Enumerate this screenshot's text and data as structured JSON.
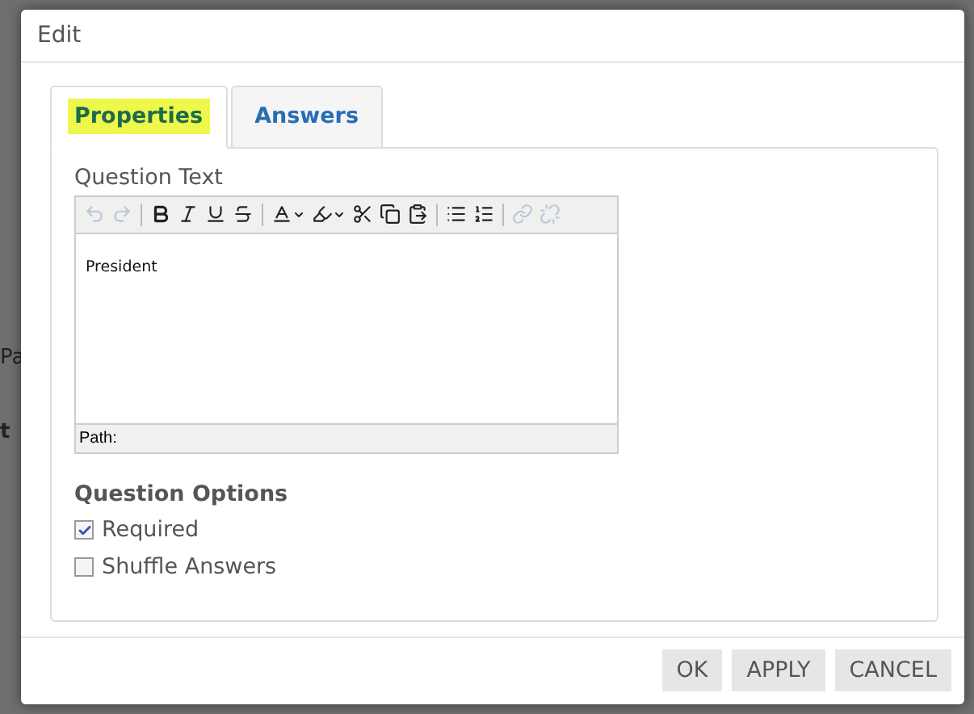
{
  "background": {
    "texts": [
      "Pa",
      "t"
    ]
  },
  "dialog": {
    "title": "Edit",
    "tabs": [
      {
        "label": "Properties",
        "selected": true
      },
      {
        "label": "Answers",
        "selected": false
      }
    ],
    "question_text": {
      "label": "Question Text",
      "content": "President",
      "path_label": "Path:",
      "toolbar": [
        {
          "kind": "undo",
          "disabled": true
        },
        {
          "kind": "redo",
          "disabled": true
        },
        {
          "kind": "sep"
        },
        {
          "kind": "bold",
          "disabled": false
        },
        {
          "kind": "italic",
          "disabled": false
        },
        {
          "kind": "underline",
          "disabled": false
        },
        {
          "kind": "strike",
          "disabled": false
        },
        {
          "kind": "sep"
        },
        {
          "kind": "textcolor",
          "disabled": false
        },
        {
          "kind": "highlight",
          "disabled": false
        },
        {
          "kind": "cut",
          "disabled": false
        },
        {
          "kind": "copy",
          "disabled": false
        },
        {
          "kind": "paste",
          "disabled": false
        },
        {
          "kind": "sep"
        },
        {
          "kind": "bullets",
          "disabled": false
        },
        {
          "kind": "numbers",
          "disabled": false
        },
        {
          "kind": "sep"
        },
        {
          "kind": "link",
          "disabled": true
        },
        {
          "kind": "unlink",
          "disabled": true
        }
      ]
    },
    "options": {
      "heading": "Question Options",
      "items": [
        {
          "label": "Required",
          "checked": true
        },
        {
          "label": "Shuffle Answers",
          "checked": false
        }
      ]
    },
    "buttons": [
      "OK",
      "APPLY",
      "CANCEL"
    ]
  }
}
